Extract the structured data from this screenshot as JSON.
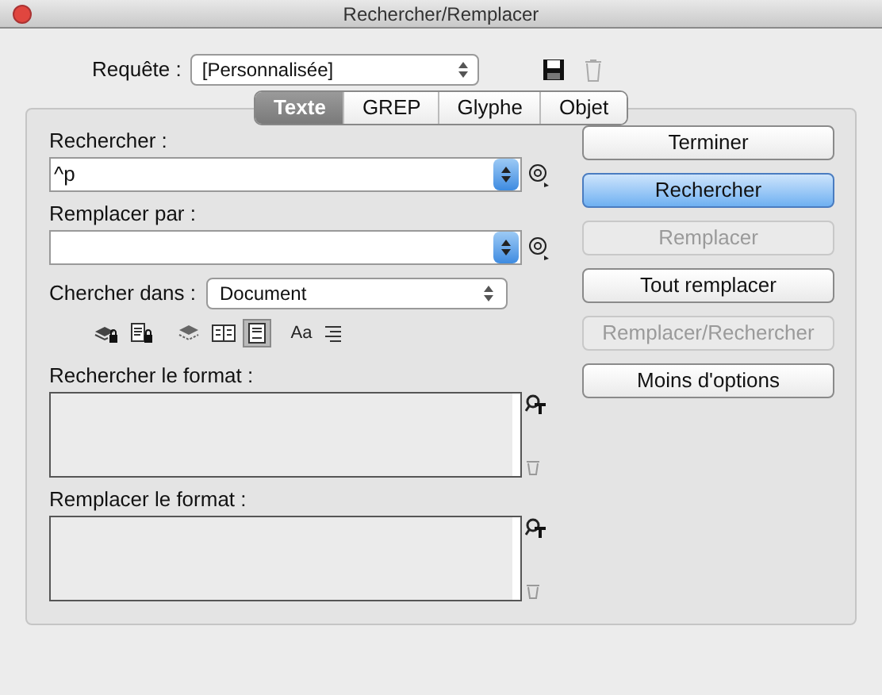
{
  "window": {
    "title": "Rechercher/Remplacer"
  },
  "query": {
    "label": "Requête :",
    "value": "[Personnalisée]"
  },
  "tabs": [
    {
      "label": "Texte",
      "selected": true
    },
    {
      "label": "GREP",
      "selected": false
    },
    {
      "label": "Glyphe",
      "selected": false
    },
    {
      "label": "Objet",
      "selected": false
    }
  ],
  "find": {
    "label": "Rechercher :",
    "value": "^p"
  },
  "replace": {
    "label": "Remplacer par :"
  },
  "search_in": {
    "label": "Chercher dans :",
    "value": "Document"
  },
  "options": [
    {
      "kind": "locked-layers",
      "on": false
    },
    {
      "kind": "locked-stories",
      "on": false
    },
    {
      "kind": "hidden-layers",
      "on": false
    },
    {
      "kind": "master-pages",
      "on": false
    },
    {
      "kind": "footnotes",
      "on": true
    },
    {
      "kind": "case",
      "label": "Aa",
      "on": false
    },
    {
      "kind": "whole-word",
      "on": false
    }
  ],
  "find_format": {
    "label": "Rechercher le format :"
  },
  "replace_format": {
    "label": "Remplacer le format :"
  },
  "buttons": [
    {
      "label": "Terminer",
      "default": false,
      "disabled": false
    },
    {
      "label": "Rechercher",
      "default": true,
      "disabled": false
    },
    {
      "label": "Remplacer",
      "default": false,
      "disabled": true
    },
    {
      "label": "Tout remplacer",
      "default": false,
      "disabled": false
    },
    {
      "label": "Remplacer/Rechercher",
      "default": false,
      "disabled": true
    },
    {
      "label": "Moins d'options",
      "default": false,
      "disabled": false
    }
  ]
}
